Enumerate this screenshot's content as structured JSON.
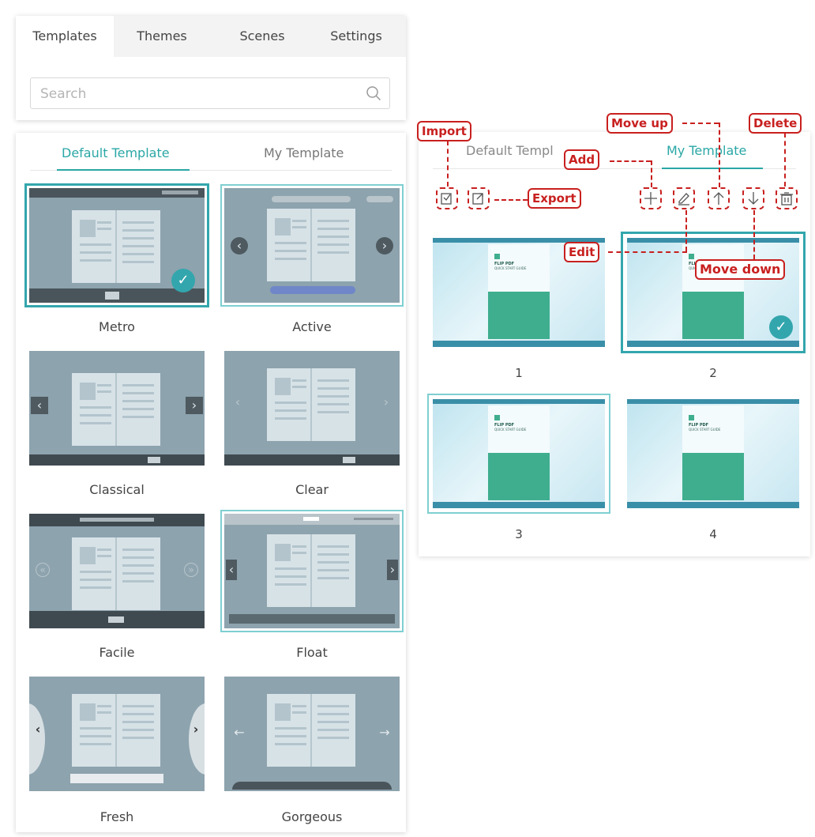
{
  "main_tabs": [
    "Templates",
    "Themes",
    "Scenes",
    "Settings"
  ],
  "search": {
    "placeholder": "Search"
  },
  "left_sub_tabs": {
    "default": "Default Template",
    "mine": "My Template"
  },
  "templates": [
    "Metro",
    "Active",
    "Classical",
    "Clear",
    "Facile",
    "Float",
    "Fresh",
    "Gorgeous"
  ],
  "right_sub_tabs": {
    "default": "Default Templ",
    "mine": "My Template"
  },
  "my_templates": [
    "1",
    "2",
    "3",
    "4"
  ],
  "my_template_book": {
    "title": "FLIP PDF",
    "subtitle": "QUICK START GUIDE"
  },
  "annotations": {
    "import": "Import",
    "export": "Export",
    "add": "Add",
    "edit": "Edit",
    "move_up": "Move up",
    "move_down": "Move down",
    "delete": "Delete"
  },
  "colors": {
    "accent": "#2aa7a5",
    "annotation": "#c8201f",
    "thumb_bg": "#8da3ae"
  },
  "icons": [
    "search-icon",
    "import-icon",
    "export-icon",
    "add-icon",
    "edit-icon",
    "move-up-icon",
    "move-down-icon",
    "delete-icon",
    "check-icon"
  ]
}
